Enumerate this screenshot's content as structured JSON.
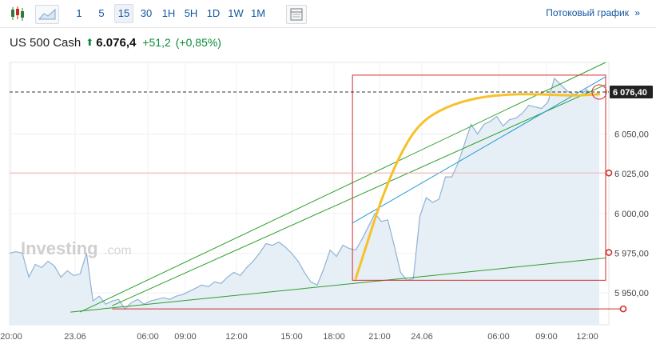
{
  "toolbar": {
    "intervals": [
      "1",
      "5",
      "15",
      "30",
      "1H",
      "5H",
      "1D",
      "1W",
      "1M"
    ],
    "active_interval": "15",
    "stream_label": "Потоковый график",
    "stream_arrow": "»"
  },
  "quote": {
    "name": "US 500 Cash",
    "arrow": "⬆",
    "price": "6.076,4",
    "change": "+51,2",
    "change_pct": "(+0,85%)"
  },
  "colors": {
    "area_line": "#8fb3d4",
    "area_fill": "#e6eef6",
    "green_lines": "#2ca02c",
    "blue_line": "#1f9bd6",
    "red_annotations": "#d32f2f",
    "yellow_curve": "#f6c12b",
    "price_tag": "#222222",
    "link": "#1256a0"
  },
  "chart_data": {
    "type": "area",
    "watermark": "Investing",
    "watermark_suffix": ".com",
    "x_tick_labels": [
      "20:00",
      "23.06",
      "06:00",
      "09:00",
      "12:00",
      "15:00",
      "18:00",
      "21:00",
      "24.06",
      "06:00",
      "09:00",
      "12:00"
    ],
    "y_tick_labels": [
      "6 050,00",
      "6 025,00",
      "6 000,00",
      "5 975,00",
      "5 950,00"
    ],
    "y_ticks": [
      6050,
      6025,
      6000,
      5975,
      5950
    ],
    "ylim": [
      5930,
      6095
    ],
    "last_price": 6076.4,
    "last_price_label": "6 076,40",
    "grid": true,
    "x": [
      0,
      2,
      4,
      6,
      8,
      10,
      12,
      14,
      16,
      18,
      20,
      22,
      24,
      26,
      28,
      30,
      32,
      34,
      36,
      38,
      40,
      42,
      44,
      46,
      48,
      50,
      52,
      54,
      56,
      58,
      60,
      62,
      64,
      66,
      68,
      70,
      72,
      74,
      76,
      78,
      80,
      82,
      84,
      86,
      88,
      90,
      92,
      94,
      96,
      98,
      100,
      102,
      104,
      106,
      108,
      110,
      112,
      114,
      116,
      118,
      120,
      122,
      124,
      126,
      128,
      130,
      132,
      134,
      136,
      138,
      140,
      142,
      144,
      146,
      148,
      150,
      152,
      154,
      156,
      158,
      160,
      162,
      164,
      166,
      168,
      170,
      172,
      174,
      176,
      178,
      180,
      182,
      184
    ],
    "values": [
      5975,
      5976,
      5975,
      5960,
      5968,
      5966,
      5970,
      5967,
      5960,
      5964,
      5961,
      5962,
      5975,
      5945,
      5948,
      5943,
      5945,
      5946,
      5940,
      5944,
      5946,
      5943,
      5945,
      5946,
      5947,
      5946,
      5948,
      5949,
      5951,
      5953,
      5955,
      5954,
      5957,
      5956,
      5960,
      5963,
      5961,
      5966,
      5970,
      5975,
      5981,
      5980,
      5982,
      5979,
      5975,
      5970,
      5963,
      5957,
      5955,
      5965,
      5977,
      5973,
      5980,
      5978,
      5977,
      5984,
      5992,
      6000,
      5995,
      5996,
      5980,
      5963,
      5958,
      5959,
      5998,
      6010,
      6007,
      6009,
      6023,
      6023,
      6032,
      6044,
      6056,
      6050,
      6056,
      6058,
      6061,
      6055,
      6059,
      6060,
      6063,
      6068,
      6067,
      6066,
      6070,
      6085,
      6081,
      6077,
      6075,
      6074,
      6078,
      6074,
      6076.4
    ],
    "annotations": {
      "green_lines": [
        [
          [
            22,
            5938
          ],
          [
            186,
            6095
          ]
        ],
        [
          [
            32,
            5942
          ],
          [
            186,
            6081
          ]
        ],
        [
          [
            19,
            5938
          ],
          [
            186,
            5972
          ]
        ]
      ],
      "blue_line": [
        [
          107,
          5994
        ],
        [
          186,
          6086
        ]
      ],
      "red_rectangle": {
        "x": [
          107,
          186
        ],
        "y": [
          5958,
          6087
        ]
      },
      "red_hlines": [
        {
          "y": 6025.5,
          "x_from": 0,
          "x_to": 187
        },
        {
          "y": 5940,
          "x_from": 32,
          "x_to": 187
        }
      ],
      "yellow_curve": [
        [
          108,
          5959
        ],
        [
          112,
          5984
        ],
        [
          116,
          6009
        ],
        [
          122,
          6038
        ],
        [
          128,
          6057
        ],
        [
          136,
          6067
        ],
        [
          146,
          6073
        ],
        [
          156,
          6075
        ],
        [
          166,
          6075
        ],
        [
          176,
          6074
        ],
        [
          184,
          6075
        ]
      ],
      "dashed_price_line": 6076.4,
      "red_circle_markers": [
        [
          187,
          6025.5
        ],
        [
          187,
          5975.5
        ],
        [
          187,
          5940
        ],
        [
          184,
          6076.4
        ]
      ]
    }
  }
}
